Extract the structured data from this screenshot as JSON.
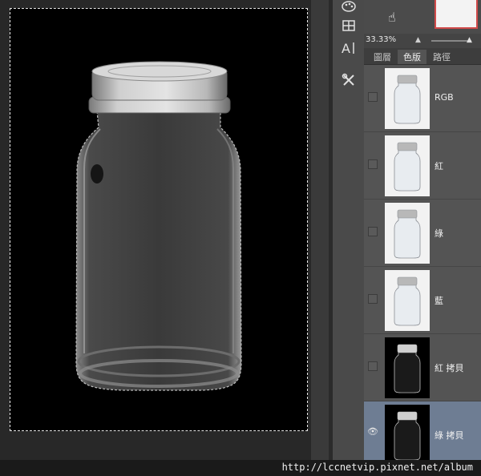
{
  "navigator": {
    "zoom": "33.33%"
  },
  "tools": [
    {
      "icon": "palette-icon"
    },
    {
      "icon": "grid-icon"
    },
    {
      "icon": "character-icon"
    },
    {
      "icon": "tools-icon"
    }
  ],
  "tabs": [
    {
      "label": "圖層",
      "active": false
    },
    {
      "label": "色版",
      "active": true
    },
    {
      "label": "路徑",
      "active": false
    }
  ],
  "channels": [
    {
      "name": "RGB",
      "visible": false,
      "thumb": "light",
      "selected": false
    },
    {
      "name": "紅",
      "visible": false,
      "thumb": "light",
      "selected": false
    },
    {
      "name": "綠",
      "visible": false,
      "thumb": "light",
      "selected": false
    },
    {
      "name": "藍",
      "visible": false,
      "thumb": "light",
      "selected": false
    },
    {
      "name": "紅 拷貝",
      "visible": false,
      "thumb": "dark",
      "selected": false
    },
    {
      "name": "綠 拷貝",
      "visible": true,
      "thumb": "dark",
      "selected": true
    }
  ],
  "watermark": "http://lccnetvip.pixnet.net/album"
}
